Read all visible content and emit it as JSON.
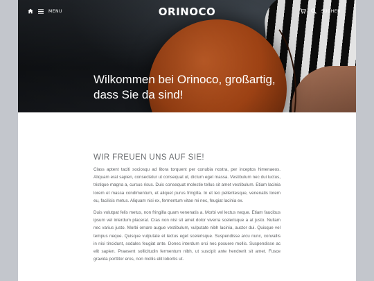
{
  "header": {
    "logo": "ORINOCO",
    "menu_label": "MENU",
    "search_label": "SUCHEN",
    "icons": [
      "home-icon",
      "menu-icon",
      "cart-icon",
      "search-icon"
    ]
  },
  "hero": {
    "title_line1": "Wilkommen bei Orinoco, großartig,",
    "title_line2": "dass Sie da sind!"
  },
  "main": {
    "heading": "WIR FREUEN UNS AUF SIE!",
    "paragraphs": [
      "Class aptent taciti sociosqu ad litora torquent per conubia nostra, per inceptos himenaeos. Aliquam erat sapien, consectetur ut consequat ut, dictum eget massa. Vestibulum nec dui luctus, tristique magna a, cursus risus. Duis consequat molestie tellus sit amet vestibulum. Etiam lacinia lorem et massa condimentum, et aliquet purus fringilla. In et leo pellentesque, venenatis lorem eu, facilisis metus. Aliquam nisi ex, fermentum vitae mi nec, feugiat lacinia ex.",
      "Duis volutpat felis metus, non fringilla quam venenatis a. Morbi vel lectus neque. Etiam faucibus ipsum vel interdum placerat. Cras non nisi sit amet dolor viverra scelerisque a at justo. Nullam nec varius justo. Morbi ornare augue vestibulum, vulputate nibh lacinia, auctor dui. Quisque vel tempus neque. Quisque vulputate et lectus eget scelerisque. Suspendisse arcu nunc, convallis in nisi tincidunt, sodales feugiat ante. Donec interdum orci nec posuere mollis. Suspendisse ac elit sapien. Praesent sollicitudin fermentum nibh, ut suscipit ante hendrerit sit amet. Fusce gravida porttitor eros, non mollis elit lobortis ut."
    ]
  }
}
